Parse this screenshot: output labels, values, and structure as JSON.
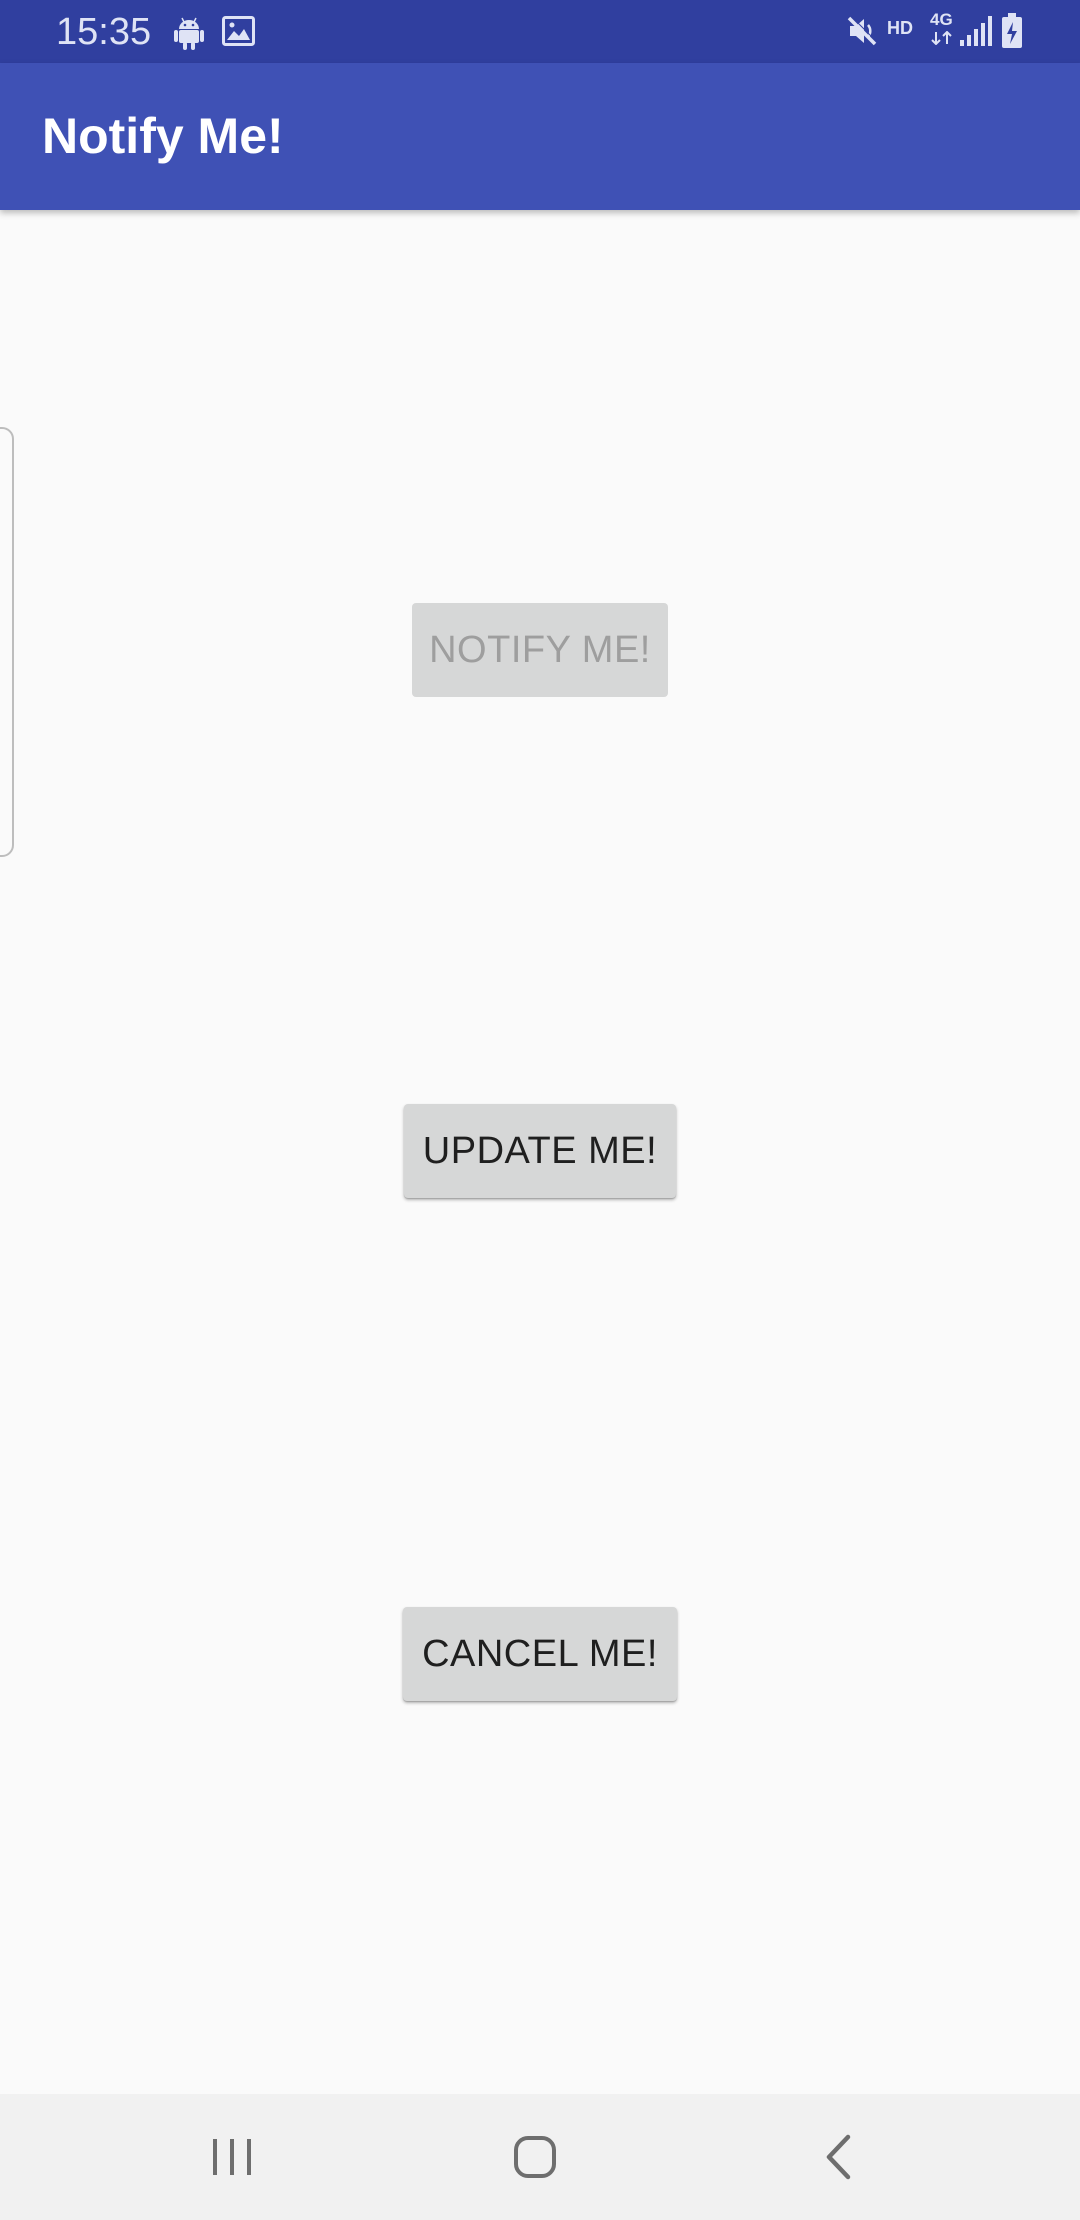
{
  "status_bar": {
    "time": "15:35",
    "icons": [
      "android-icon",
      "image-icon",
      "mute-icon",
      "hd-icon",
      "4g-icon",
      "signal-icon",
      "battery-charging-icon"
    ],
    "hd_label": "HD",
    "network_label": "4G",
    "background": "#303f9f"
  },
  "app_bar": {
    "title": "Notify Me!",
    "background": "#3f51b5"
  },
  "buttons": {
    "notify": {
      "label": "NOTIFY ME!",
      "enabled": false
    },
    "update": {
      "label": "UPDATE ME!",
      "enabled": true
    },
    "cancel": {
      "label": "CANCEL ME!",
      "enabled": true
    }
  },
  "nav_bar": {
    "items": [
      "recents-icon",
      "home-icon",
      "back-icon"
    ]
  }
}
